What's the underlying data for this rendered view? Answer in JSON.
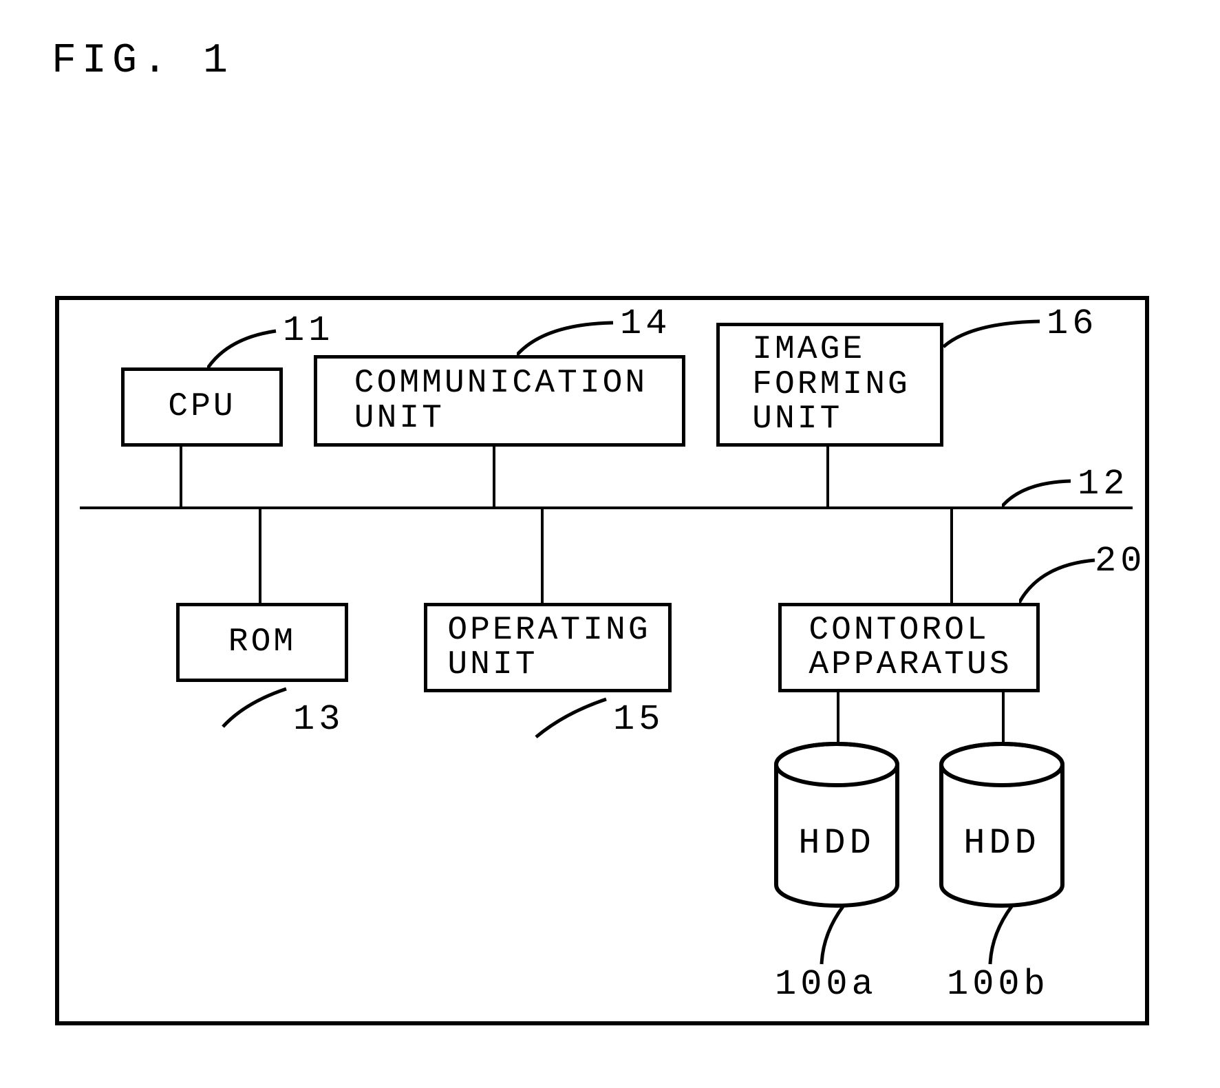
{
  "figure_label": "FIG. 1",
  "blocks": {
    "cpu": {
      "text": "CPU",
      "ref": "11"
    },
    "comm": {
      "text": "COMMUNICATION\nUNIT",
      "ref": "14"
    },
    "image": {
      "text": "IMAGE\nFORMING\nUNIT",
      "ref": "16"
    },
    "rom": {
      "text": "ROM",
      "ref": "13"
    },
    "operating": {
      "text": "OPERATING\nUNIT",
      "ref": "15"
    },
    "control": {
      "text": "CONTOROL\nAPPARATUS",
      "ref": "20"
    }
  },
  "bus_ref": "12",
  "hdd_a": {
    "text": "HDD",
    "ref": "100a"
  },
  "hdd_b": {
    "text": "HDD",
    "ref": "100b"
  }
}
